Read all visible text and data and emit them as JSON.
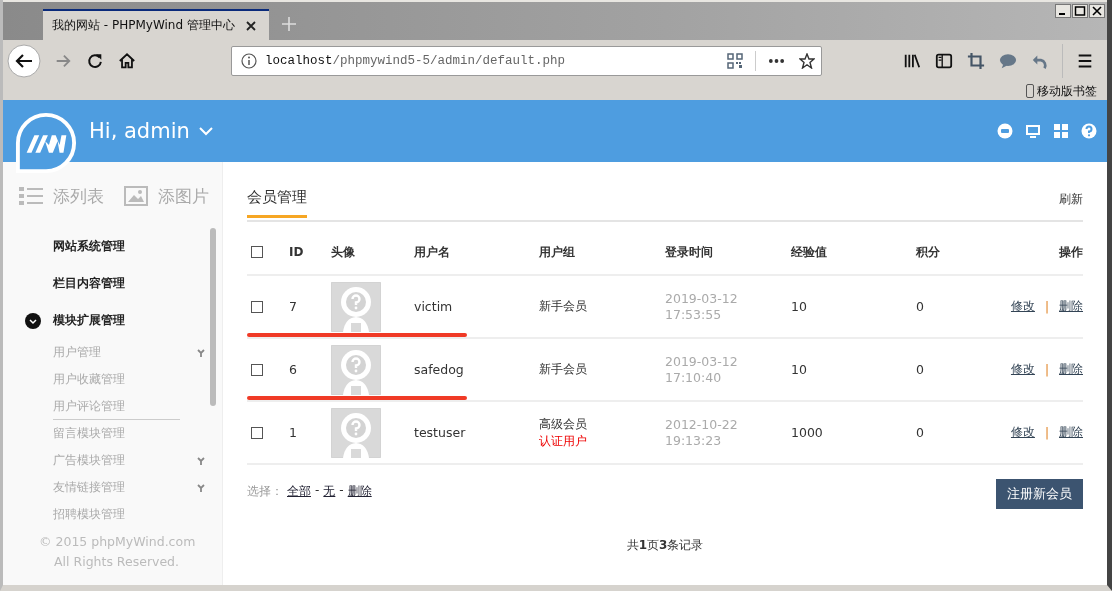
{
  "browser": {
    "tab_title": "我的网站 - PHPMyWind 管理中心",
    "url_host": "localhost",
    "url_path": "/phpmywind5-5/admin/default.php",
    "bookmark": "移动版书签"
  },
  "header": {
    "greeting": "Hi, admin"
  },
  "sidebar": {
    "tabs": [
      {
        "label": "添列表",
        "kind": "list"
      },
      {
        "label": "添图片",
        "kind": "image"
      }
    ],
    "menu": [
      {
        "label": "网站系统管理",
        "expanded": false
      },
      {
        "label": "栏目内容管理",
        "expanded": false
      },
      {
        "label": "模块扩展管理",
        "expanded": true,
        "children": [
          {
            "label": "用户管理",
            "has_submenu": true,
            "hovered": false
          },
          {
            "label": "用户收藏管理",
            "has_submenu": false,
            "hovered": false
          },
          {
            "label": "用户评论管理",
            "has_submenu": false,
            "hovered": true
          },
          {
            "label": "留言模块管理",
            "has_submenu": false,
            "hovered": false
          },
          {
            "label": "广告模块管理",
            "has_submenu": true,
            "hovered": false
          },
          {
            "label": "友情链接管理",
            "has_submenu": true,
            "hovered": false
          },
          {
            "label": "招聘模块管理",
            "has_submenu": false,
            "hovered": false
          }
        ]
      }
    ],
    "footer": [
      "© 2015 phpMyWind.com",
      "All Rights Reserved."
    ]
  },
  "panel": {
    "title": "会员管理",
    "refresh": "刷新"
  },
  "table": {
    "select_all_checked": false,
    "columns": [
      "ID",
      "头像",
      "用户名",
      "用户组",
      "登录时间",
      "经验值",
      "积分",
      "操作"
    ],
    "rows": [
      {
        "checked": false,
        "id": "7",
        "username": "victim",
        "groups": [
          {
            "label": "新手会员",
            "kind": "normal"
          }
        ],
        "login_date": "2019-03-12",
        "login_time": "17:53:55",
        "exp": "10",
        "points": "0",
        "actions": [
          {
            "kind": "link",
            "label": "修改"
          },
          {
            "kind": "separator",
            "label": "|"
          },
          {
            "kind": "link",
            "label": "删除"
          }
        ],
        "underlined": true
      },
      {
        "checked": false,
        "id": "6",
        "username": "safedog",
        "groups": [
          {
            "label": "新手会员",
            "kind": "normal"
          }
        ],
        "login_date": "2019-03-12",
        "login_time": "17:10:40",
        "exp": "10",
        "points": "0",
        "actions": [
          {
            "kind": "link",
            "label": "修改"
          },
          {
            "kind": "separator",
            "label": "|"
          },
          {
            "kind": "link",
            "label": "删除"
          }
        ],
        "underlined": true
      },
      {
        "checked": false,
        "id": "1",
        "username": "testuser",
        "groups": [
          {
            "label": "高级会员",
            "kind": "normal"
          },
          {
            "label": "认证用户",
            "kind": "verified"
          }
        ],
        "login_date": "2012-10-22",
        "login_time": "19:13:23",
        "exp": "1000",
        "points": "0",
        "actions": [
          {
            "kind": "link",
            "label": "修改"
          },
          {
            "kind": "separator",
            "label": "|"
          },
          {
            "kind": "link",
            "label": "删除"
          }
        ],
        "underlined": false
      }
    ]
  },
  "selection": {
    "label": "选择：",
    "items": [
      {
        "kind": "link",
        "label": "全部"
      },
      {
        "kind": "separator",
        "label": "-"
      },
      {
        "kind": "link",
        "label": "无"
      },
      {
        "kind": "separator",
        "label": "-"
      },
      {
        "kind": "link",
        "label": "删除"
      }
    ]
  },
  "register_button": "注册新会员",
  "pagination": "共**1**页**3**条记录"
}
